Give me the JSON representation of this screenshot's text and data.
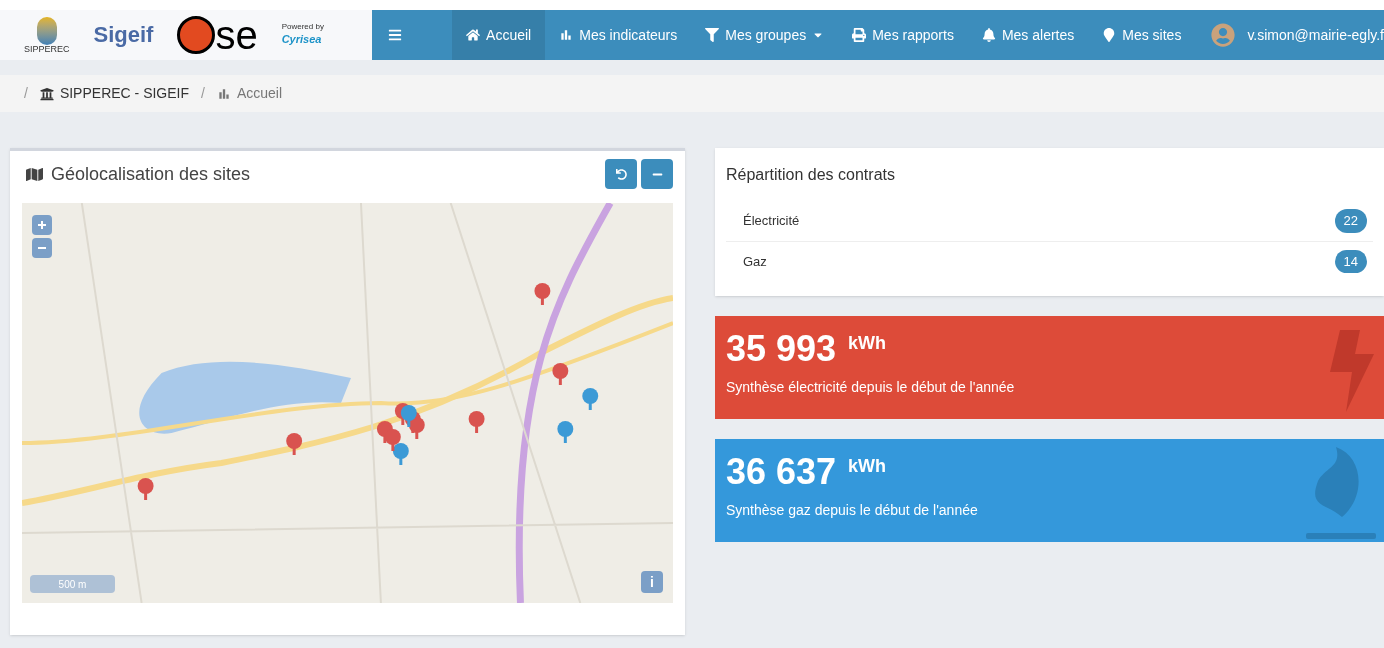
{
  "logos": {
    "sipperec": "SIPPEREC",
    "sigeif": "Sigeif",
    "ose": "se",
    "powered_by": "Powered by",
    "cyrisea": "Cyrisea"
  },
  "nav": [
    {
      "label": "Accueil",
      "selected": true,
      "dropdown": false
    },
    {
      "label": "Mes indicateurs",
      "selected": false,
      "dropdown": false
    },
    {
      "label": "Mes groupes",
      "selected": false,
      "dropdown": true
    },
    {
      "label": "Mes rapports",
      "selected": false,
      "dropdown": false
    },
    {
      "label": "Mes alertes",
      "selected": false,
      "dropdown": false
    },
    {
      "label": "Mes sites",
      "selected": false,
      "dropdown": false
    }
  ],
  "user": "v.simon@mairie-egly.f",
  "breadcrumb": [
    {
      "separator": "/",
      "label": "SIPPEREC - SIGEIF"
    },
    {
      "separator": "/",
      "label": "Accueil"
    }
  ],
  "map_panel": {
    "title": "Géolocalisation des sites",
    "scale": "500 m",
    "info": "i",
    "markers": [
      {
        "color": "#d9534f"
      },
      {
        "color": "#d9534f"
      },
      {
        "color": "#d9534f"
      },
      {
        "color": "#3c9ad6"
      },
      {
        "color": "#d9534f"
      },
      {
        "color": "#d9534f"
      },
      {
        "color": "#d9534f"
      },
      {
        "color": "#d9534f"
      },
      {
        "color": "#3c9ad6"
      },
      {
        "color": "#d9534f"
      },
      {
        "color": "#d9534f"
      },
      {
        "color": "#3c9ad6"
      },
      {
        "color": "#d9534f"
      },
      {
        "color": "#3c9ad6"
      }
    ]
  },
  "contracts": {
    "title": "Répartition des contrats",
    "items": [
      {
        "label": "Électricité",
        "count": "22"
      },
      {
        "label": "Gaz",
        "count": "14"
      }
    ]
  },
  "stats": [
    {
      "kind": "electricity",
      "value": "35 993",
      "unit": "kWh",
      "caption": "Synthèse électricité depuis le début de l'année"
    },
    {
      "kind": "gas",
      "value": "36 637",
      "unit": "kWh",
      "caption": "Synthèse gaz depuis le début de l'année"
    }
  ]
}
